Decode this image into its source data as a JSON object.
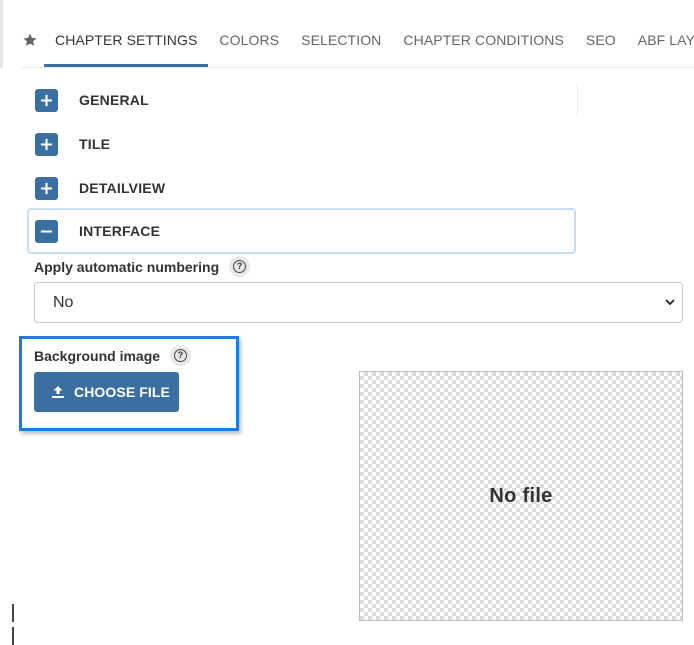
{
  "tabs": {
    "items": [
      {
        "label": "CHAPTER SETTINGS",
        "active": true
      },
      {
        "label": "COLORS"
      },
      {
        "label": "SELECTION"
      },
      {
        "label": "CHAPTER CONDITIONS"
      },
      {
        "label": "SEO"
      },
      {
        "label": "ABF LAYOUT"
      }
    ],
    "favorite_icon": "star-icon"
  },
  "sections": [
    {
      "label": "GENERAL",
      "icon": "plus-icon",
      "expanded": false
    },
    {
      "label": "TILE",
      "icon": "plus-icon",
      "expanded": false
    },
    {
      "label": "DETAILVIEW",
      "icon": "plus-icon",
      "expanded": false
    },
    {
      "label": "INTERFACE",
      "icon": "minus-icon",
      "expanded": true
    }
  ],
  "interface": {
    "numbering": {
      "label": "Apply automatic numbering",
      "help_icon": "help-icon",
      "value": "No"
    },
    "background_image": {
      "label": "Background image",
      "help_icon": "help-icon",
      "button_label": "CHOOSE FILE",
      "button_icon": "upload-icon",
      "preview_text": "No file"
    }
  },
  "colors": {
    "accent": "#3a6f9f",
    "highlight_border": "#1e7be6",
    "expanded_border": "#c8ddf2"
  }
}
